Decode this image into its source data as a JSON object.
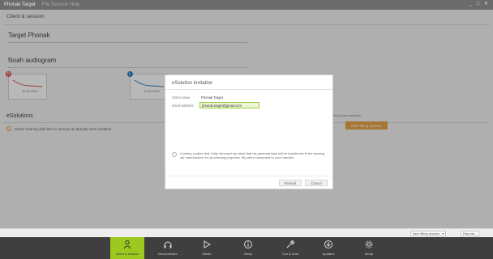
{
  "titlebar": {
    "app_name": "Phonak Target",
    "menu_text": "File  Session  Help",
    "window_controls": "_ □ ✕"
  },
  "breadcrumb": "Client & session",
  "client": {
    "name": "Target Phonak"
  },
  "audiogram": {
    "heading": "Noah audiogram",
    "cards": [
      {
        "side": "R",
        "date": "11.09.2020",
        "color": "#d9534f"
      },
      {
        "side": "L",
        "date": "11.09.2020",
        "color": "#2f7fc1"
      }
    ]
  },
  "esolutions": {
    "heading": "eSolutions",
    "info_text": "Select hearing aids first or remove an already sent invitation",
    "no_fitting_text": "No fitting data available",
    "new_fitting_button": "New fitting session"
  },
  "dialog": {
    "title": "eSolution invitation",
    "client_name_label": "Client name",
    "client_name_value": "Phonak Target",
    "email_label": "Email address",
    "email_value": "phonak.target@gmail.com",
    "consent_text": "I hereby confirm that I fully informed my client that his personal data will be transferred to the hearing aid manufacturer for processing purposes. My client consented to such transfer.",
    "send_button": "Resend",
    "cancel_button": "Cancel"
  },
  "actionbar": {
    "new_session_select": "New fitting session",
    "reports_button": "Reports..."
  },
  "navbar": {
    "items": [
      {
        "label": "Client & session",
        "icon": "person-icon",
        "active": true
      },
      {
        "label": "Demonstrator",
        "icon": "headphones-icon",
        "active": false
      },
      {
        "label": "Media",
        "icon": "play-icon",
        "active": false
      },
      {
        "label": "News",
        "icon": "info-icon",
        "active": false
      },
      {
        "label": "Tool & tools",
        "icon": "wrench-icon",
        "active": false
      },
      {
        "label": "Updates",
        "icon": "download-icon",
        "active": false
      },
      {
        "label": "Setup",
        "icon": "gear-icon",
        "active": false
      }
    ]
  }
}
